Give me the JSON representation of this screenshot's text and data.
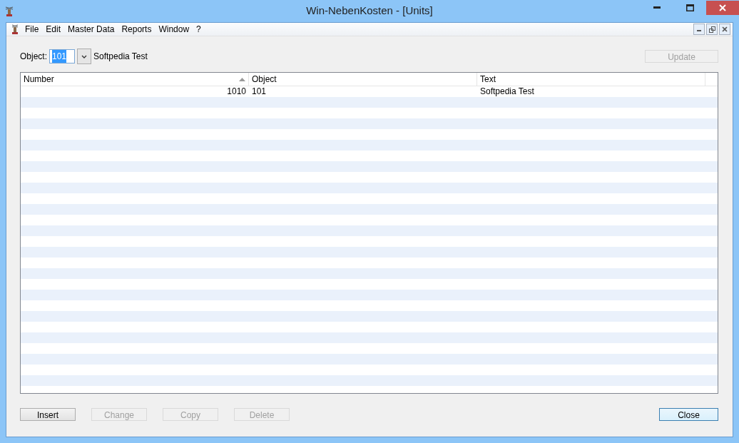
{
  "window": {
    "title": "Win-NebenKosten - [Units]"
  },
  "menu": [
    {
      "label": "File"
    },
    {
      "label": "Edit"
    },
    {
      "label": "Master Data"
    },
    {
      "label": "Reports"
    },
    {
      "label": "Window"
    },
    {
      "label": "?"
    }
  ],
  "object_filter": {
    "label": "Object:",
    "value": "101",
    "value_selected": true,
    "description": "Softpedia Test"
  },
  "update_button": {
    "label": "Update",
    "disabled": true
  },
  "table": {
    "columns": [
      {
        "label": "Number",
        "sorted": true,
        "kind": "number"
      },
      {
        "label": "Object",
        "sorted": false,
        "kind": "text"
      },
      {
        "label": "Text",
        "sorted": false,
        "kind": "text"
      }
    ],
    "rows": [
      {
        "cells": [
          "1010",
          "101",
          "Softpedia Test"
        ]
      }
    ]
  },
  "buttons": [
    {
      "label": "Insert",
      "disabled": false,
      "focused": false
    },
    {
      "label": "Change",
      "disabled": true,
      "focused": false
    },
    {
      "label": "Copy",
      "disabled": true,
      "focused": false
    },
    {
      "label": "Delete",
      "disabled": true,
      "focused": false
    }
  ],
  "close_button": {
    "label": "Close",
    "disabled": false,
    "focused": true
  }
}
